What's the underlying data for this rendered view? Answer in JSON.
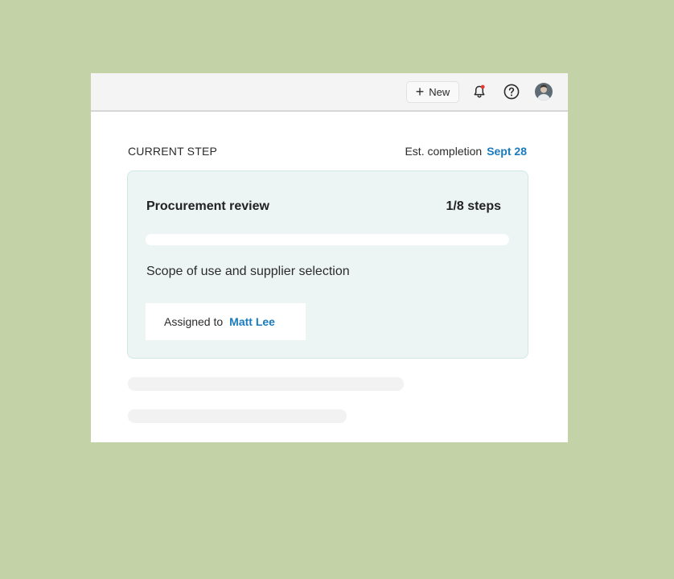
{
  "toolbar": {
    "new_label": "New",
    "notification_dot_color": "#e53935"
  },
  "step": {
    "section_label": "CURRENT STEP",
    "est_label": "Est. completion",
    "est_date": "Sept 28",
    "title": "Procurement review",
    "steps_text": "1/8 steps",
    "current_step": 1,
    "total_steps": 8,
    "description": "Scope of use and supplier selection",
    "assigned_label": "Assigned to",
    "assignee": "Matt Lee"
  },
  "colors": {
    "accent": "#1a7bbd",
    "background": "#c4d2a7",
    "card_bg": "#edf5f4"
  }
}
